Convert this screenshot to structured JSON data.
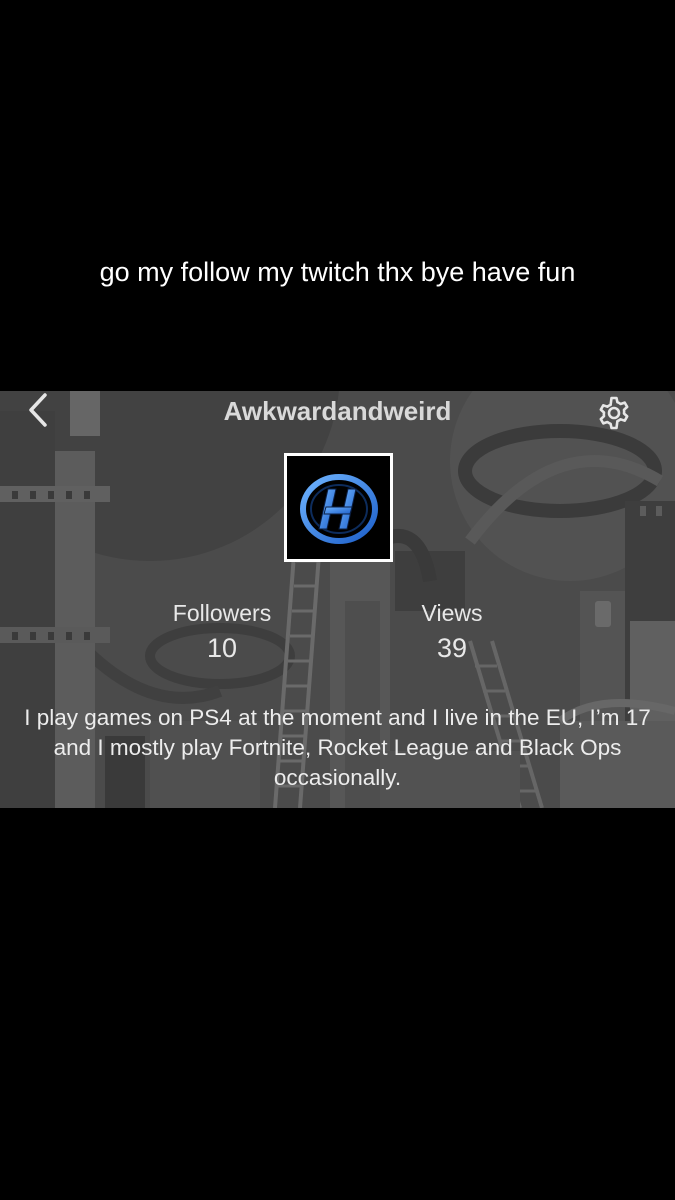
{
  "caption": "go my follow my twitch thx bye have fun",
  "profile": {
    "username": "Awkwardandweird",
    "avatar_icon": "stylized-H-logo",
    "followers_label": "Followers",
    "followers_value": "10",
    "views_label": "Views",
    "views_value": "39",
    "bio": "I play games on PS4 at the moment and I live in the EU, I’m 17 and I mostly play Fortnite, Rocket League and Black Ops occasionally."
  },
  "icons": {
    "back": "chevron-left-icon",
    "settings": "gear-icon"
  },
  "colors": {
    "page_background": "#000000",
    "profile_background": "#4a4a4a",
    "logo_blue": "#2f7fe8"
  }
}
